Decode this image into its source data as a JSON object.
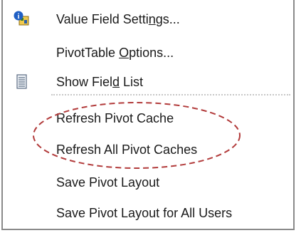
{
  "menu": {
    "items": [
      {
        "label_pre": "Value Field Setti",
        "label_u": "n",
        "label_post": "gs...",
        "icon": "field-settings-icon"
      },
      {
        "label_pre": "PivotTable ",
        "label_u": "O",
        "label_post": "ptions...",
        "icon": ""
      },
      {
        "label_pre": "Show Fiel",
        "label_u": "d",
        "label_post": " List",
        "icon": "field-list-icon"
      },
      {
        "label_pre": "Refresh Pivot Cache",
        "label_u": "",
        "label_post": "",
        "icon": ""
      },
      {
        "label_pre": "Refresh All Pivot Caches",
        "label_u": "",
        "label_post": "",
        "icon": ""
      },
      {
        "label_pre": "Save Pivot Layout",
        "label_u": "",
        "label_post": "",
        "icon": ""
      },
      {
        "label_pre": "Save Pivot Layout for All Users",
        "label_u": "",
        "label_post": "",
        "icon": ""
      }
    ]
  },
  "annotation": {
    "color": "#b23b3b"
  }
}
